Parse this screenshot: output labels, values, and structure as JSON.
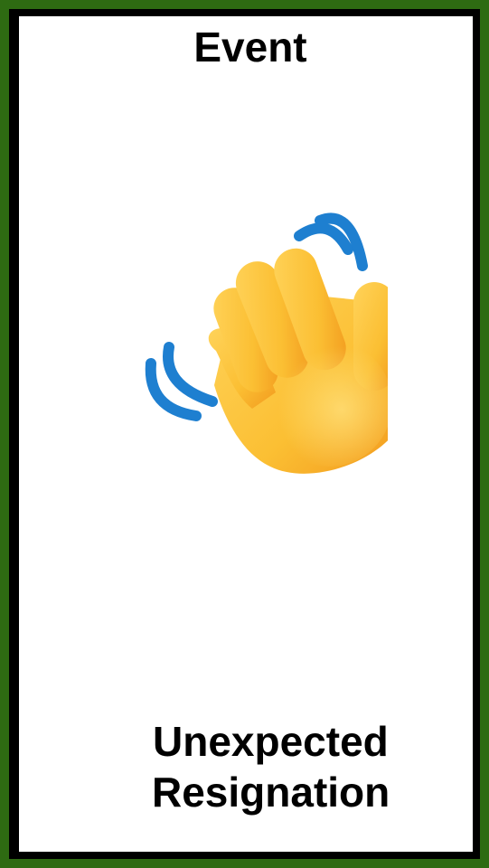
{
  "card": {
    "title": "Event",
    "caption_line1": "Unexpected",
    "caption_line2": "Resignation",
    "icon": "waving-hand-icon",
    "colors": {
      "outer_border": "#2e6b12",
      "inner_border": "#000000",
      "background": "#ffffff",
      "hand": "#fbc43c",
      "motion_lines": "#1e7fd0"
    }
  }
}
